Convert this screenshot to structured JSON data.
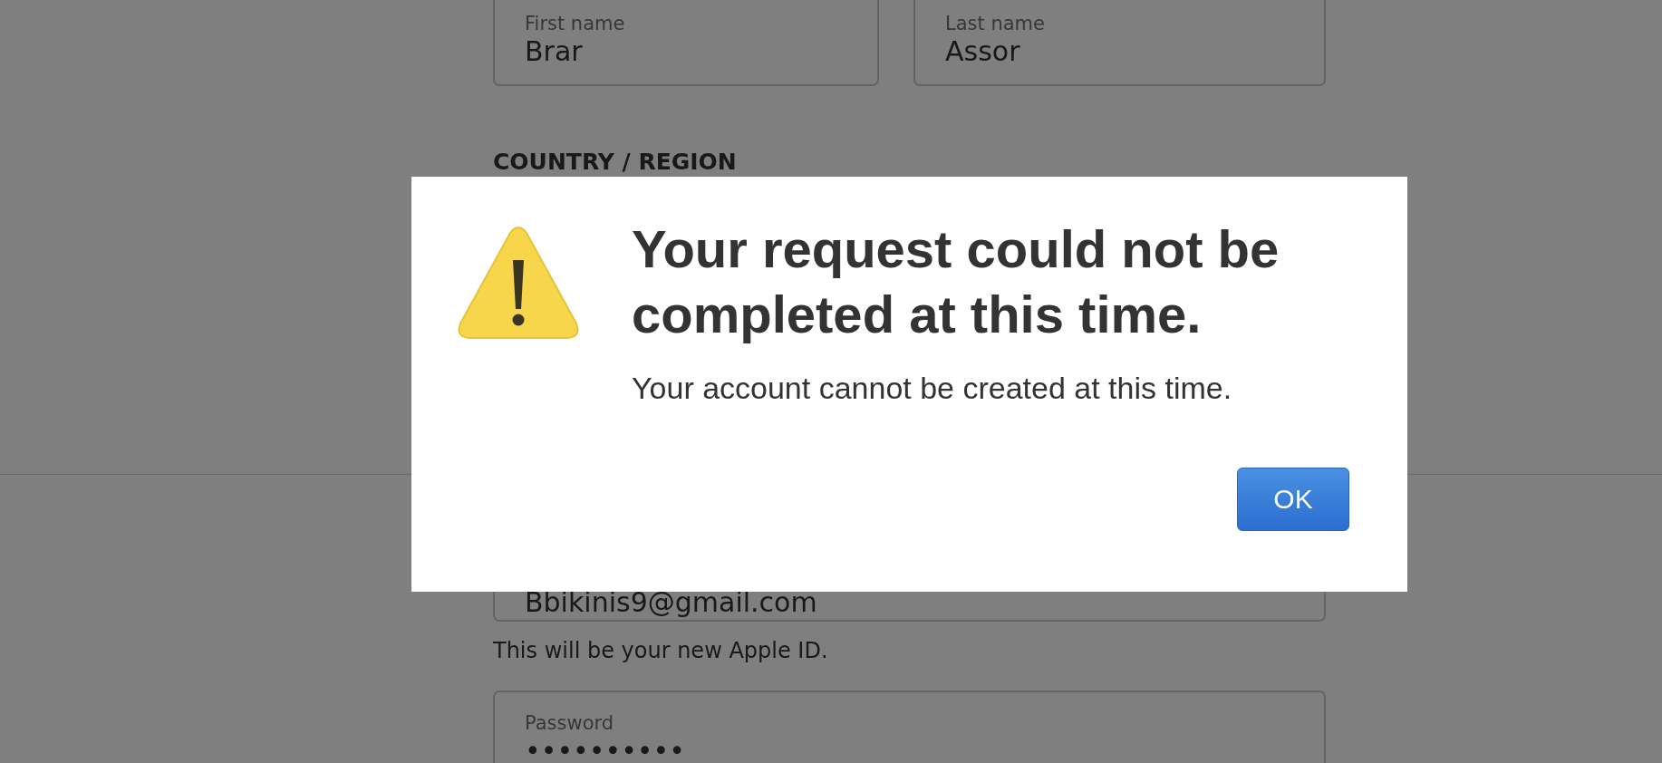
{
  "form": {
    "name_fields": [
      {
        "label": "First name",
        "value": "Brar"
      },
      {
        "label": "Last name",
        "value": "Assor"
      }
    ],
    "country_heading": "COUNTRY / REGION",
    "email_field": {
      "value": "Bbikinis9@gmail.com"
    },
    "email_hint": "This will be your new Apple ID.",
    "password_field": {
      "label": "Password",
      "value": "••••••••••"
    }
  },
  "alert": {
    "title": "Your request could not be completed at this time.",
    "message": "Your account cannot be created at this time.",
    "buttons": [
      {
        "label": "OK",
        "default": true
      }
    ]
  }
}
